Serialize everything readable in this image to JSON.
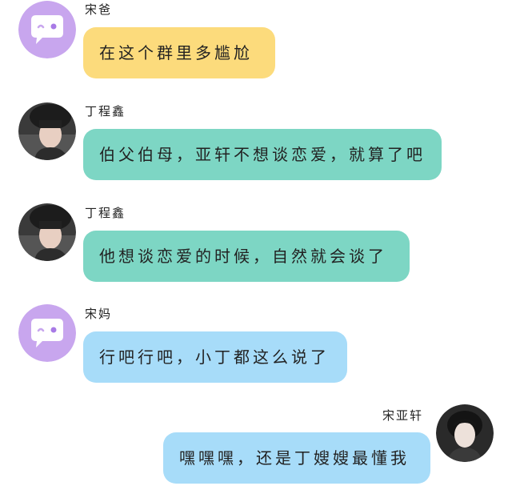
{
  "messages": [
    {
      "sender": "宋爸",
      "text": "在这个群里多尴尬",
      "side": "left",
      "avatar": "bot-icon",
      "bubble_color": "#fcdb7c"
    },
    {
      "sender": "丁程鑫",
      "text": "伯父伯母，亚轩不想谈恋爱，就算了吧",
      "side": "left",
      "avatar": "person-photo",
      "bubble_color": "#7dd6c4"
    },
    {
      "sender": "丁程鑫",
      "text": "他想谈恋爱的时候，自然就会谈了",
      "side": "left",
      "avatar": "person-photo",
      "bubble_color": "#7dd6c4"
    },
    {
      "sender": "宋妈",
      "text": "行吧行吧，小丁都这么说了",
      "side": "left",
      "avatar": "bot-icon",
      "bubble_color": "#a7dcf9"
    },
    {
      "sender": "宋亚轩",
      "text": "嘿嘿嘿，还是丁嫂嫂最懂我",
      "side": "right",
      "avatar": "person-photo",
      "bubble_color": "#a7dcf9"
    }
  ]
}
